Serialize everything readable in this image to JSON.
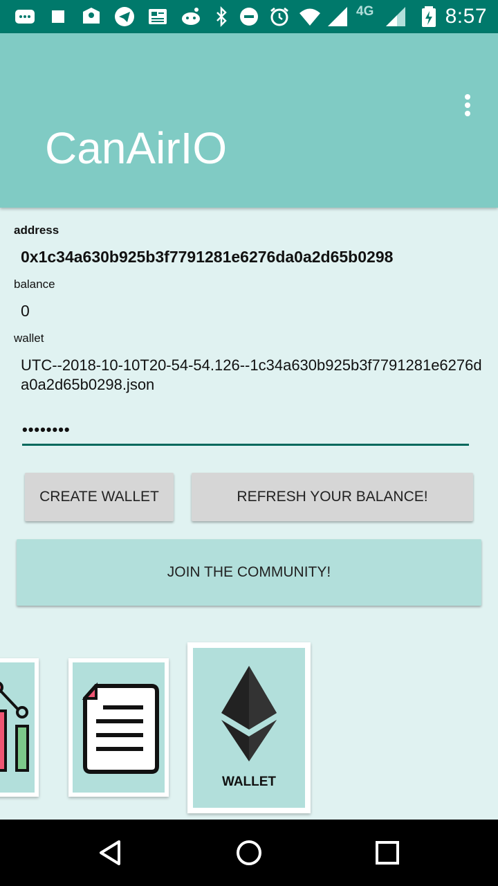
{
  "status_bar": {
    "time": "8:57",
    "network": "4G",
    "icons": [
      "messaging-icon",
      "square-icon",
      "vpn-icon",
      "telegram-icon",
      "news-icon",
      "reddit-icon",
      "bluetooth-icon",
      "do-not-disturb-icon",
      "alarm-icon",
      "wifi-icon",
      "signal-icon",
      "signal-icon-2",
      "battery-icon"
    ]
  },
  "app_bar": {
    "title": "CanAirIO",
    "menu_icon": "overflow-menu-icon"
  },
  "fields": {
    "address_label": "address",
    "address_value": "0x1c34a630b925b3f7791281e6276da0a2d65b0298",
    "balance_label": "balance",
    "balance_value": "0",
    "wallet_label": "wallet",
    "wallet_value": "UTC--2018-10-10T20-54-54.126--1c34a630b925b3f7791281e6276da0a2d65b0298.json",
    "password_value": "••••••••"
  },
  "buttons": {
    "create_wallet": "CREATE WALLET",
    "refresh_balance": "REFRESH YOUR BALANCE!",
    "join_community": "JOIN THE COMMUNITY!"
  },
  "cards": [
    {
      "icon": "chart-icon",
      "label": ""
    },
    {
      "icon": "document-icon",
      "label": ""
    },
    {
      "icon": "ethereum-icon",
      "label": "WALLET"
    }
  ],
  "colors": {
    "status_bar": "#00796b",
    "app_bar": "#80cbc4",
    "background": "#e0f2f1",
    "accent": "#00695c",
    "card_fill": "#b2dfdb"
  }
}
